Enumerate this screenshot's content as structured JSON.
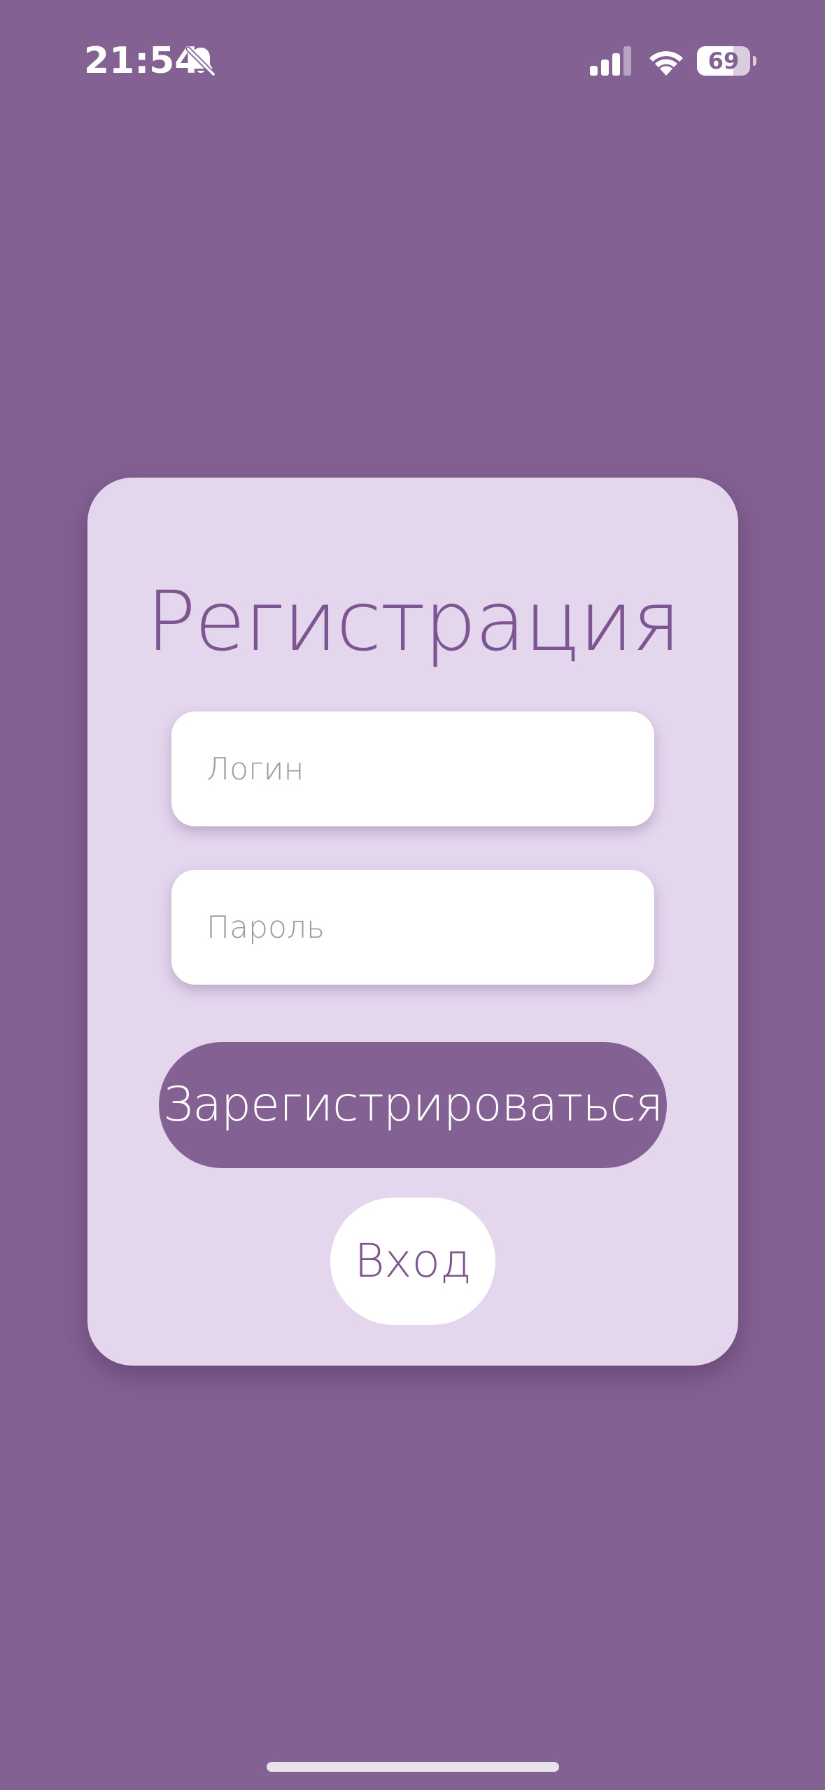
{
  "status_bar": {
    "time": "21:54",
    "battery_level": "69",
    "battery_fraction": 0.69,
    "icons": [
      "bell-slash-icon",
      "cellular-signal-icon",
      "wifi-icon",
      "battery-icon"
    ]
  },
  "card": {
    "title": "Регистрация",
    "login_placeholder": "Логин",
    "password_placeholder": "Пароль",
    "register_label": "Зарегистрироваться",
    "login_label": "Вход"
  },
  "colors": {
    "background": "#846193",
    "card": "#e4d6ed",
    "accent": "#7d5590",
    "field": "#ffffff"
  }
}
